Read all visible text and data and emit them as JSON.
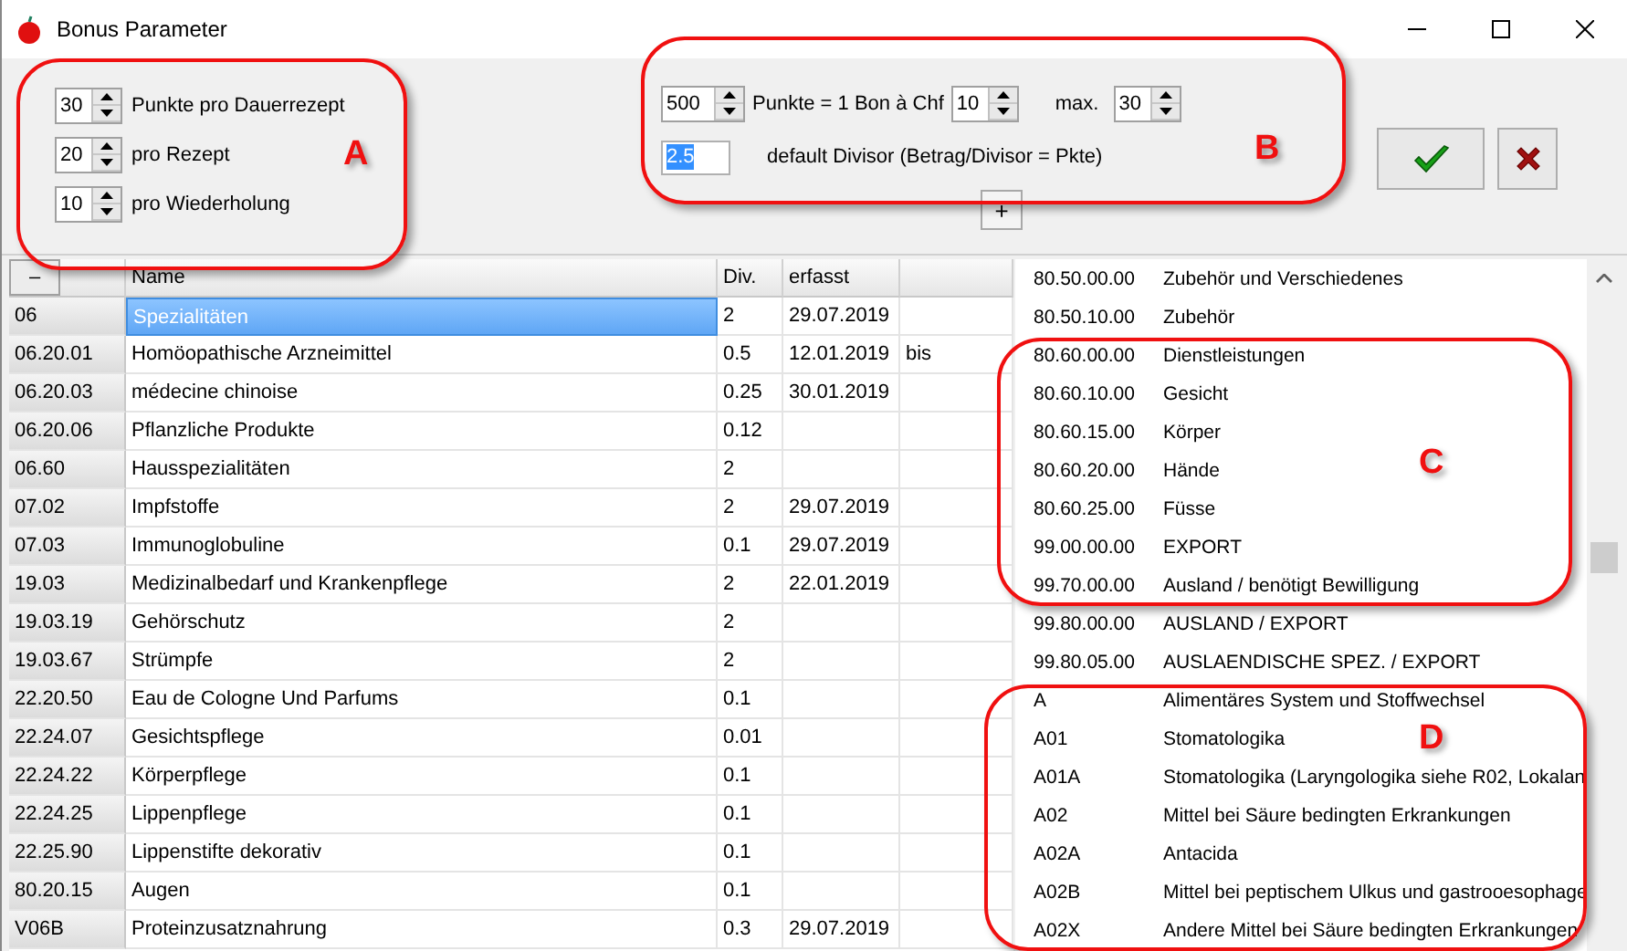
{
  "window": {
    "title": "Bonus Parameter"
  },
  "group_a": {
    "spinners": [
      {
        "value": "30",
        "label": "Punkte pro Dauerrezept"
      },
      {
        "value": "20",
        "label": "pro Rezept"
      },
      {
        "value": "10",
        "label": "pro Wiederholung"
      }
    ]
  },
  "group_b": {
    "points": {
      "value": "500",
      "label": "Punkte = 1 Bon à Chf"
    },
    "bon": {
      "value": "10",
      "label": "max."
    },
    "max": {
      "value": "30"
    },
    "divisor": {
      "value": "2.5",
      "text_selected": true,
      "label": "default Divisor (Betrag/Divisor = Pkte)"
    },
    "expand_button": "+"
  },
  "grid": {
    "collapse_button": "–",
    "columns": [
      "Name",
      "Div.",
      "erfasst"
    ],
    "rows": [
      {
        "code": "06",
        "name": "Spezialitäten",
        "div": "2",
        "date": "29.07.2019",
        "selected": true
      },
      {
        "code": "06.20.01",
        "name": "Homöopathische Arzneimittel",
        "div": "0.5",
        "date": "12.01.2019",
        "extra": "bis",
        "selected": false
      },
      {
        "code": "06.20.03",
        "name": "médecine chinoise",
        "div": "0.25",
        "date": "30.01.2019",
        "selected": false
      },
      {
        "code": "06.20.06",
        "name": "Pflanzliche Produkte",
        "div": "0.12",
        "selected": false
      },
      {
        "code": "06.60",
        "name": "Hausspezialitäten",
        "div": "2",
        "selected": false
      },
      {
        "code": "07.02",
        "name": "Impfstoffe",
        "div": "2",
        "date": "29.07.2019",
        "selected": false
      },
      {
        "code": "07.03",
        "name": "Immunoglobuline",
        "div": "0.1",
        "date": "29.07.2019",
        "selected": false
      },
      {
        "code": "19.03",
        "name": "Medizinalbedarf und Krankenpflege",
        "div": "2",
        "date": "22.01.2019",
        "selected": false
      },
      {
        "code": "19.03.19",
        "name": "Gehörschutz",
        "div": "2",
        "selected": false
      },
      {
        "code": "19.03.67",
        "name": "Strümpfe",
        "div": "2",
        "selected": false
      },
      {
        "code": "22.20.50",
        "name": "Eau de Cologne Und Parfums",
        "div": "0.1",
        "selected": false
      },
      {
        "code": "22.24.07",
        "name": "Gesichtspflege",
        "div": "0.01",
        "selected": false
      },
      {
        "code": "22.24.22",
        "name": "Körperpflege",
        "div": "0.1",
        "selected": false
      },
      {
        "code": "22.24.25",
        "name": "Lippenpflege",
        "div": "0.1",
        "selected": false
      },
      {
        "code": "22.25.90",
        "name": "Lippenstifte dekorativ",
        "div": "0.1",
        "selected": false
      },
      {
        "code": "80.20.15",
        "name": "Augen",
        "div": "0.1",
        "selected": false
      },
      {
        "code": "V06B",
        "name": "Proteinzusatznahrung",
        "div": "0.3",
        "date": "29.07.2019",
        "selected": false
      }
    ]
  },
  "category_list": [
    {
      "code": "80.50.00.00",
      "text": "Zubehör und Verschiedenes"
    },
    {
      "code": "80.50.10.00",
      "text": "Zubehör"
    },
    {
      "code": "80.60.00.00",
      "text": "Dienstleistungen"
    },
    {
      "code": "80.60.10.00",
      "text": "Gesicht"
    },
    {
      "code": "80.60.15.00",
      "text": "Körper"
    },
    {
      "code": "80.60.20.00",
      "text": "Hände"
    },
    {
      "code": "80.60.25.00",
      "text": "Füsse"
    },
    {
      "code": "99.00.00.00",
      "text": "EXPORT"
    },
    {
      "code": "99.70.00.00",
      "text": "Ausland / benötigt Bewilligung"
    },
    {
      "code": "99.80.00.00",
      "text": "AUSLAND / EXPORT"
    },
    {
      "code": "99.80.05.00",
      "text": "AUSLAENDISCHE SPEZ. / EXPORT"
    },
    {
      "code": "A",
      "text": "Alimentäres System und Stoffwechsel"
    },
    {
      "code": "A01",
      "text": "Stomatologika"
    },
    {
      "code": "A01A",
      "text": "Stomatologika (Laryngologika siehe R02, Lokalan"
    },
    {
      "code": "A02",
      "text": "Mittel bei Säure bedingten Erkrankungen"
    },
    {
      "code": "A02A",
      "text": "Antacida"
    },
    {
      "code": "A02B",
      "text": "Mittel bei peptischem Ulkus und gastrooesophage"
    },
    {
      "code": "A02X",
      "text": "Andere Mittel bei Säure bedingten Erkrankungen"
    }
  ],
  "annotations": [
    {
      "label": "A"
    },
    {
      "label": "B"
    },
    {
      "label": "C"
    },
    {
      "label": "D"
    }
  ]
}
